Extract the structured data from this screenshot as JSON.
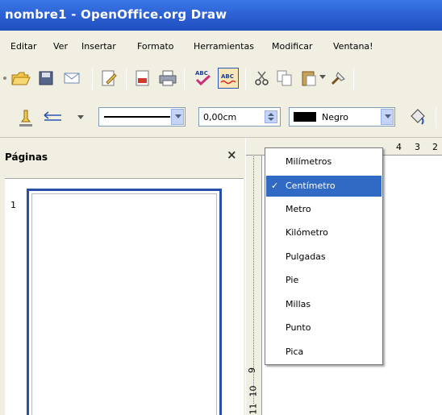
{
  "window": {
    "title": "nombre1 - OpenOffice.org Draw"
  },
  "menu": [
    "Editar",
    "Ver",
    "Insertar",
    "Formato",
    "Herramientas",
    "Modificar",
    "Ventana!"
  ],
  "toolbar2": {
    "line_width_value": "0,00cm",
    "color_value": "Negro",
    "color_swatch": "#000000"
  },
  "pages_panel": {
    "title": "Páginas",
    "close_symbol": "×",
    "page_number": "1"
  },
  "ruler": {
    "top_numbers": [
      "4",
      "3",
      "2"
    ],
    "left_numbers": [
      "9",
      "10",
      "11"
    ]
  },
  "unit_menu": {
    "items": [
      "Milímetros",
      "Centímetro",
      "Metro",
      "Kilómetro",
      "Pulgadas",
      "Pie",
      "Millas",
      "Punto",
      "Pica"
    ],
    "selected": "Centímetro",
    "check_symbol": "✓"
  },
  "colors": {
    "title_bar": "#2e62d6",
    "selection": "#316ac5",
    "chrome": "#f1efe2"
  }
}
